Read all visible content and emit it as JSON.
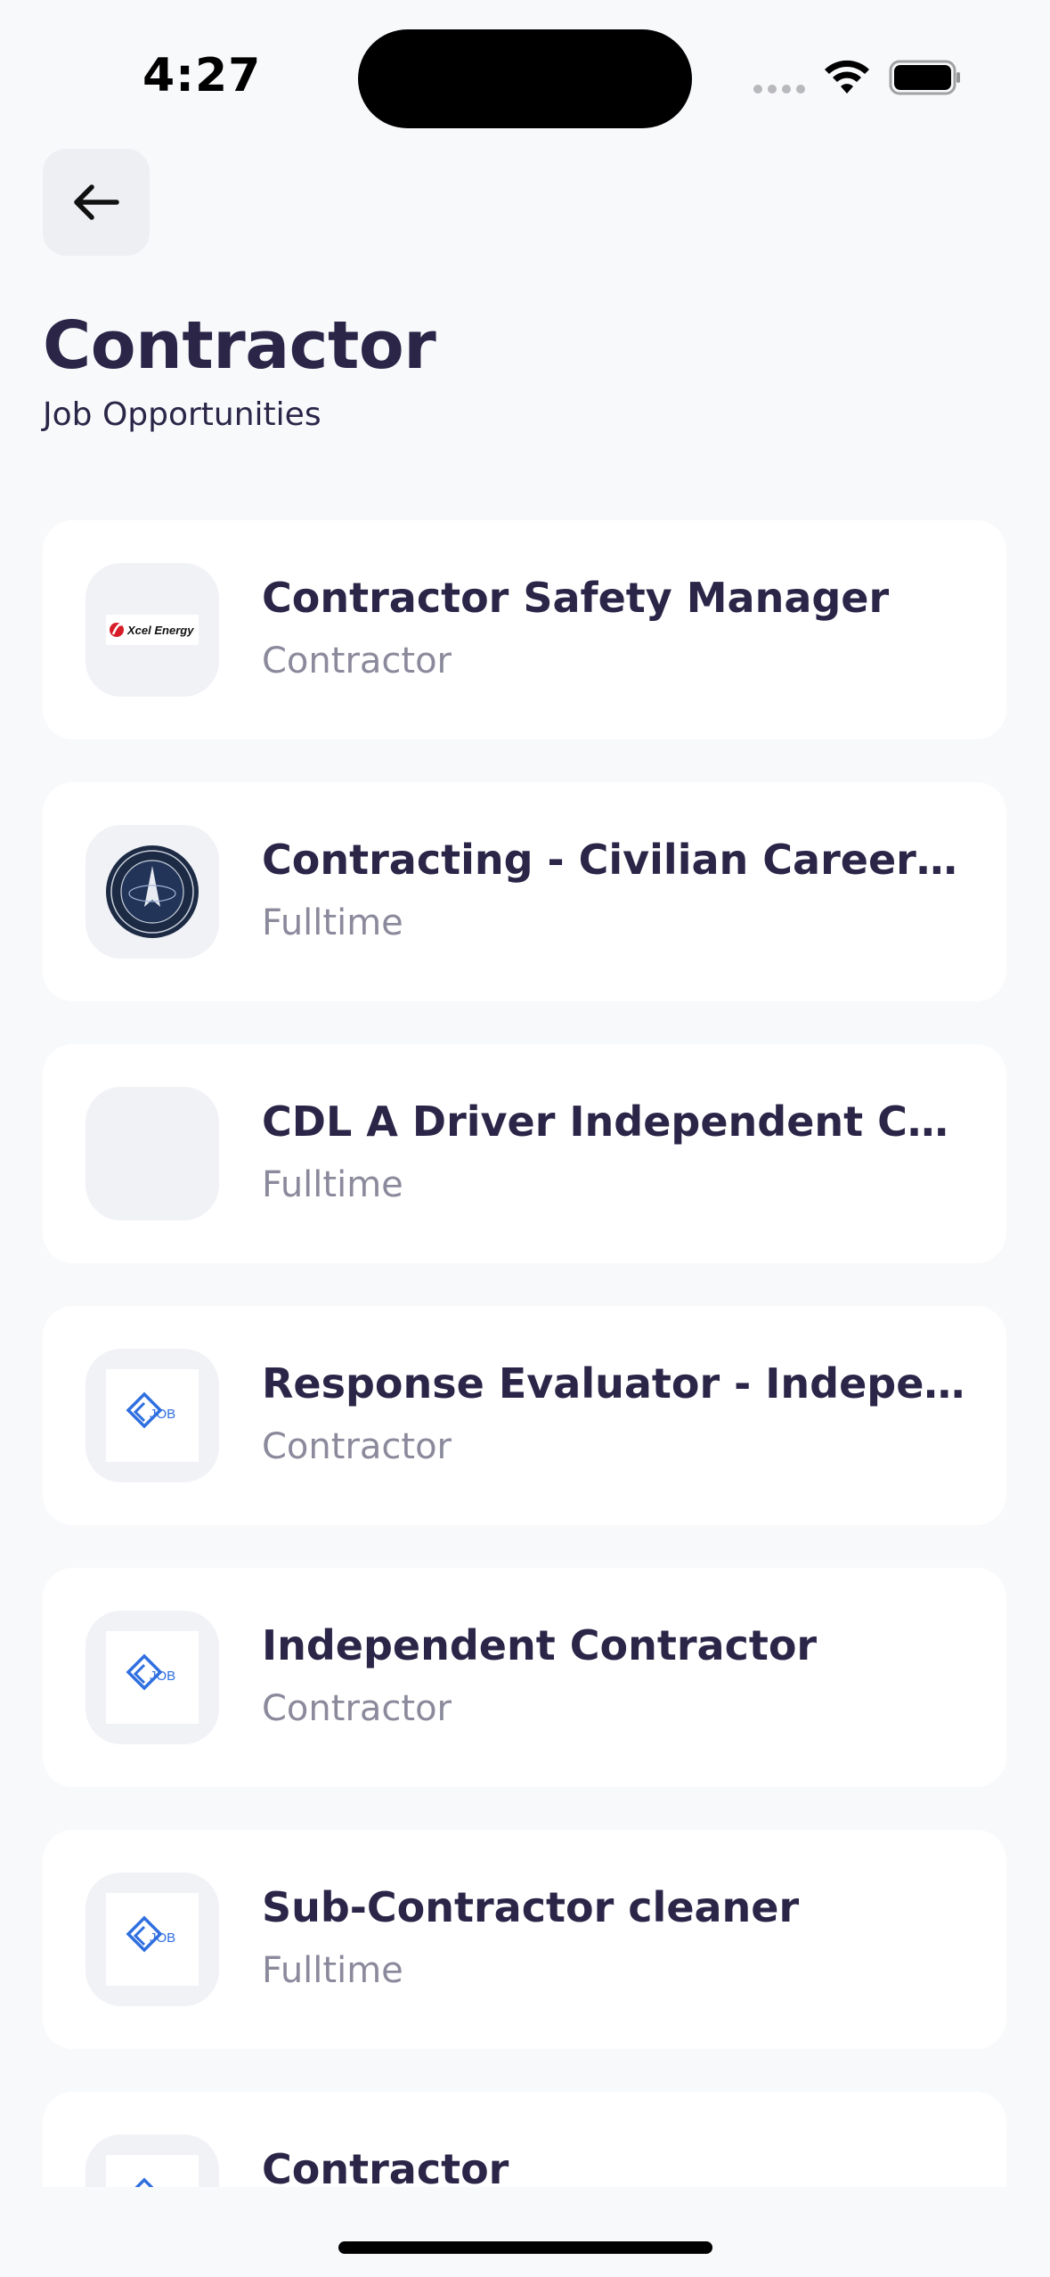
{
  "status_bar": {
    "time": "4:27"
  },
  "header": {
    "title": "Contractor",
    "subtitle": "Job Opportunities"
  },
  "jobs": [
    {
      "title": "Contractor Safety Manager",
      "type": "Contractor",
      "logo": "xcel-energy-logo"
    },
    {
      "title": "Contracting  - Civilian Careers…",
      "type": "Fulltime",
      "logo": "space-force-seal"
    },
    {
      "title": "CDL A Driver Independent Con…",
      "type": "Fulltime",
      "logo": "none"
    },
    {
      "title": "Response Evaluator - Indepen…",
      "type": "Contractor",
      "logo": "job-logo"
    },
    {
      "title": "Independent Contractor",
      "type": "Contractor",
      "logo": "job-logo"
    },
    {
      "title": "Sub-Contractor cleaner",
      "type": "Fulltime",
      "logo": "job-logo"
    },
    {
      "title": "Contractor",
      "type": "",
      "logo": "job-logo"
    }
  ],
  "logo_text": {
    "xcel": "Xcel Energy",
    "job": "JOB"
  },
  "colors": {
    "background": "#f8f9fb",
    "card": "#ffffff",
    "title_text": "#2b2548",
    "secondary_text": "#8b8a9c",
    "job_logo_blue": "#2f6fe0"
  }
}
